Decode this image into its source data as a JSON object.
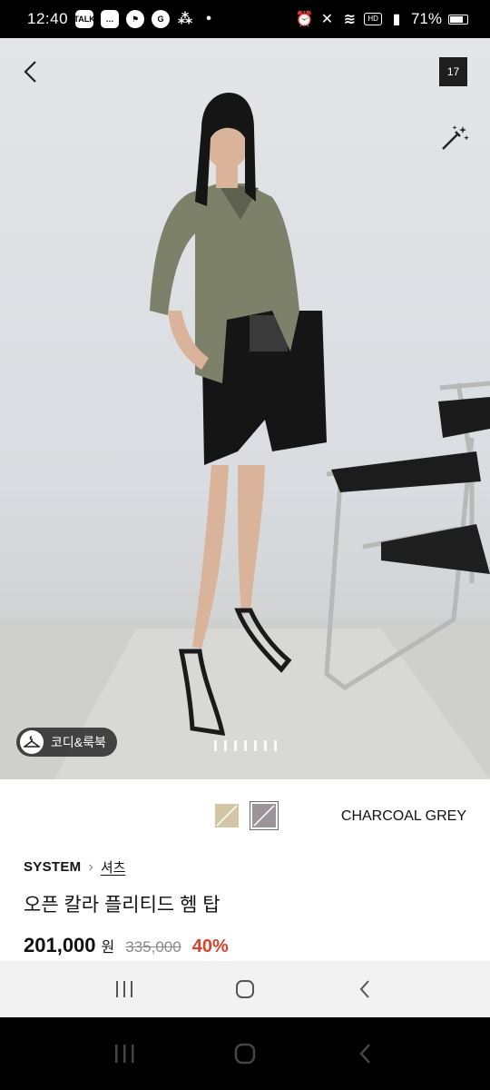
{
  "status_bar": {
    "time": "12:40",
    "battery": "71%",
    "hd_label": "HD"
  },
  "gallery": {
    "image_count": "17",
    "coordi_label": "코디&룩북",
    "page_indicator_count": 7
  },
  "product": {
    "color_name": "CHARCOAL GREY",
    "brand": "SYSTEM",
    "category": "셔츠",
    "name": "오픈 칼라 플리티드 헴 탑",
    "price": "201,000",
    "price_unit": "원",
    "original_price": "335,000",
    "discount": "40%",
    "swatches": [
      {
        "name": "beige",
        "color": "#d4c5a6"
      },
      {
        "name": "charcoal-grey",
        "color": "#9b9498",
        "selected": true
      }
    ]
  },
  "icons": {
    "back": "chevron-left-icon",
    "magic": "magic-wand-icon",
    "coordi": "hanger-icon",
    "nav_recent": "recent-apps-icon",
    "nav_home": "home-icon",
    "nav_back": "back-icon"
  }
}
